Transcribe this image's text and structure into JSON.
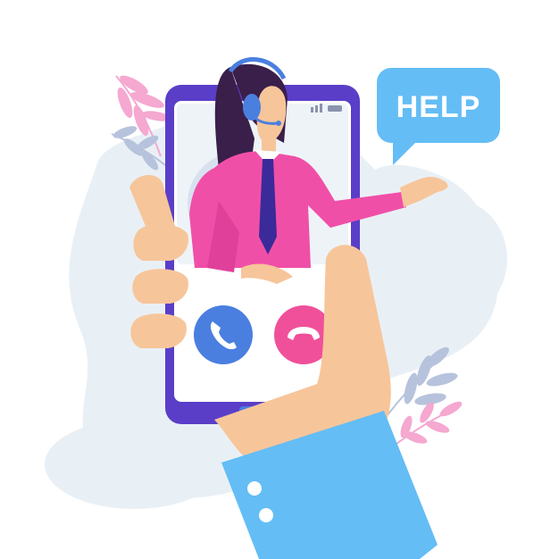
{
  "speech_bubble": {
    "text": "HELP"
  },
  "call_screen": {
    "accept_icon": "phone-handset-icon",
    "decline_icon": "phone-hangup-icon"
  },
  "colors": {
    "background_blob": "#e9f0f5",
    "phone_frame": "#5a3ec8",
    "phone_screen": "#ffffff",
    "accept": "#4a7fe0",
    "decline": "#f0509a",
    "bubble": "#64bdf5",
    "sleeve": "#64bdf5",
    "skin": "#f7c59a",
    "agent_shirt": "#f04fa8",
    "agent_hair": "#3a1f4a",
    "tie": "#3b2a9a",
    "headset": "#4a7fe0",
    "leaf_pink": "#f5a8d0",
    "leaf_blue": "#b7c3dc"
  }
}
